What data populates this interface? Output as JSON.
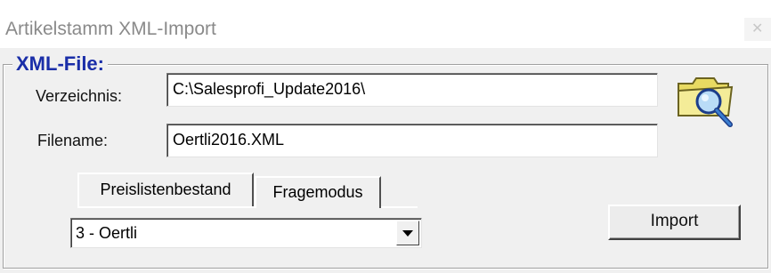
{
  "window": {
    "title": "Artikelstamm XML-Import",
    "close_glyph": "✕"
  },
  "group": {
    "legend": "XML-File:"
  },
  "fields": {
    "verzeichnis_label": "Verzeichnis:",
    "verzeichnis_value": "C:\\Salesprofi_Update2016\\",
    "filename_label": "Filename:",
    "filename_value": "Oertli2016.XML"
  },
  "tabs": [
    {
      "label": "Preislistenbestand",
      "active": true
    },
    {
      "label": "Fragemodus",
      "active": false
    }
  ],
  "select": {
    "selected": "3 - Oertli"
  },
  "buttons": {
    "import_label": "Import",
    "browse_icon": "folder-search-icon"
  },
  "colors": {
    "legend": "#1a2ea8",
    "folder": "#f4e98a",
    "magnifier": "#3b7fd0"
  }
}
